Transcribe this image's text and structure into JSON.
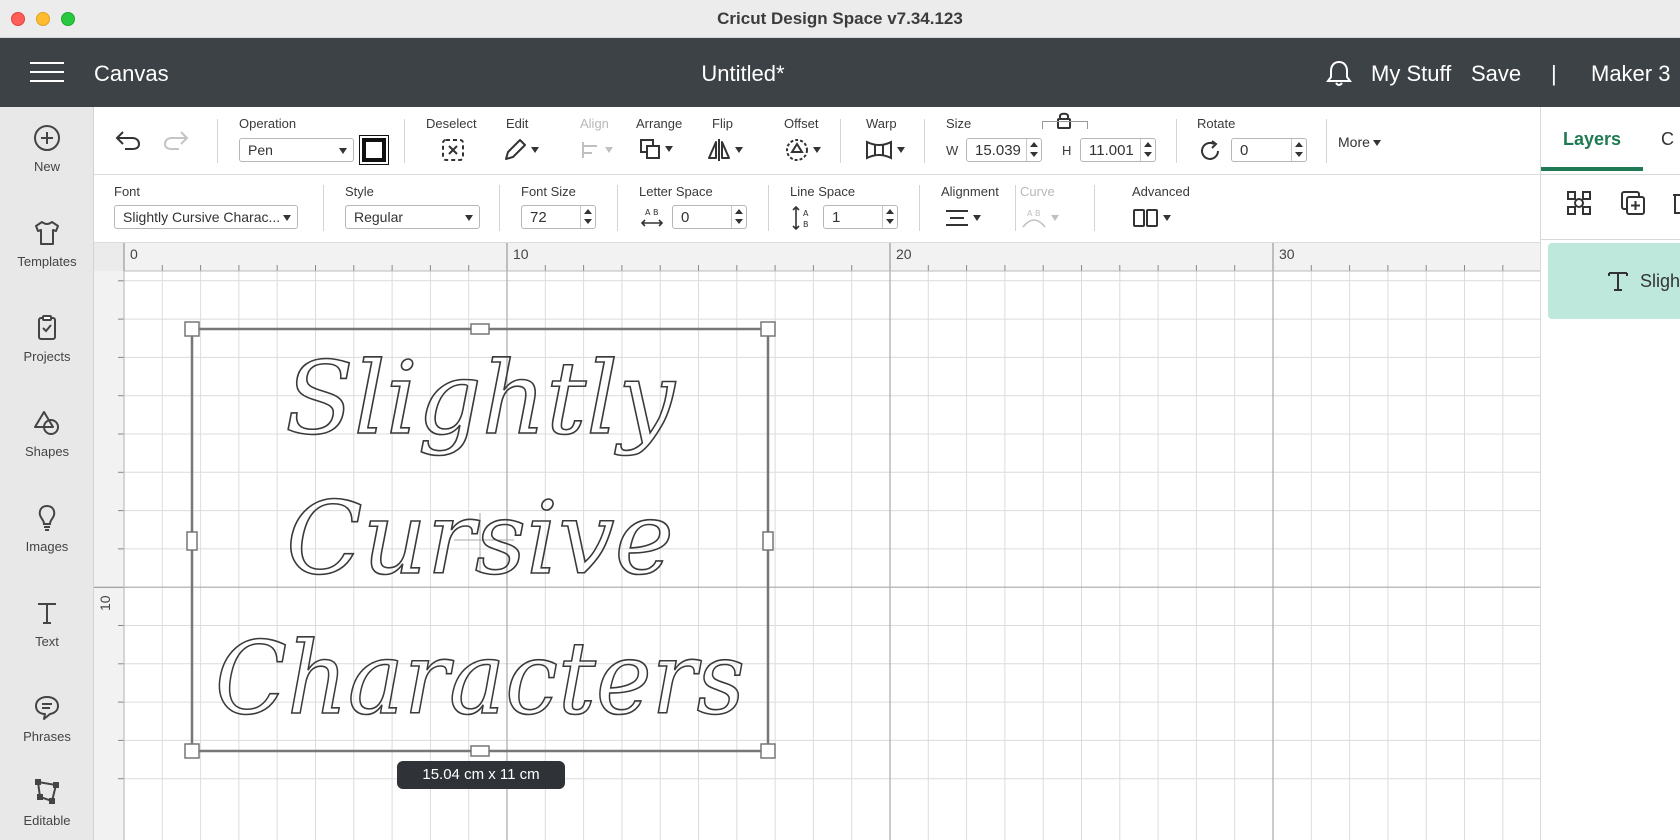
{
  "window": {
    "title": "Cricut Design Space  v7.34.123"
  },
  "header": {
    "section": "Canvas",
    "doc_title": "Untitled*",
    "my_stuff": "My Stuff",
    "save": "Save",
    "divider": "|",
    "machine": "Maker 3"
  },
  "sidebar": {
    "items": [
      {
        "label": "New",
        "icon": "plus-circle-icon"
      },
      {
        "label": "Templates",
        "icon": "tshirt-icon"
      },
      {
        "label": "Projects",
        "icon": "clipboard-icon"
      },
      {
        "label": "Shapes",
        "icon": "shapes-icon"
      },
      {
        "label": "Images",
        "icon": "lightbulb-icon"
      },
      {
        "label": "Text",
        "icon": "text-t-icon"
      },
      {
        "label": "Phrases",
        "icon": "speech-bubble-icon"
      },
      {
        "label": "Editable",
        "icon": "node-edit-icon"
      }
    ]
  },
  "toolbar1": {
    "operation_label": "Operation",
    "operation_value": "Pen",
    "deselect": "Deselect",
    "edit": "Edit",
    "align": "Align",
    "arrange": "Arrange",
    "flip": "Flip",
    "offset": "Offset",
    "warp": "Warp",
    "size": "Size",
    "w_label": "W",
    "w_value": "15.039",
    "h_label": "H",
    "h_value": "11.001",
    "rotate": "Rotate",
    "rotate_value": "0",
    "more": "More"
  },
  "toolbar2": {
    "font_label": "Font",
    "font_value": "Slightly Cursive Charac...",
    "style_label": "Style",
    "style_value": "Regular",
    "font_size_label": "Font Size",
    "font_size_value": "72",
    "letter_space_label": "Letter Space",
    "letter_space_value": "0",
    "line_space_label": "Line Space",
    "line_space_value": "1",
    "alignment_label": "Alignment",
    "curve_label": "Curve",
    "advanced_label": "Advanced"
  },
  "right_panel": {
    "tab_layers": "Layers",
    "tab_other": "C",
    "layer_name": "Sligh"
  },
  "canvas": {
    "ruler_top": [
      "0",
      "10",
      "20",
      "30"
    ],
    "ruler_left": [
      "10"
    ],
    "text_lines": [
      "Slightly",
      "Cursive",
      "Characters"
    ],
    "dimension_tooltip": "15.04  cm x 11  cm"
  },
  "colors": {
    "header_bg": "#3d4246",
    "accent": "#1f7a53",
    "layer_bg": "#bfe8dc"
  }
}
